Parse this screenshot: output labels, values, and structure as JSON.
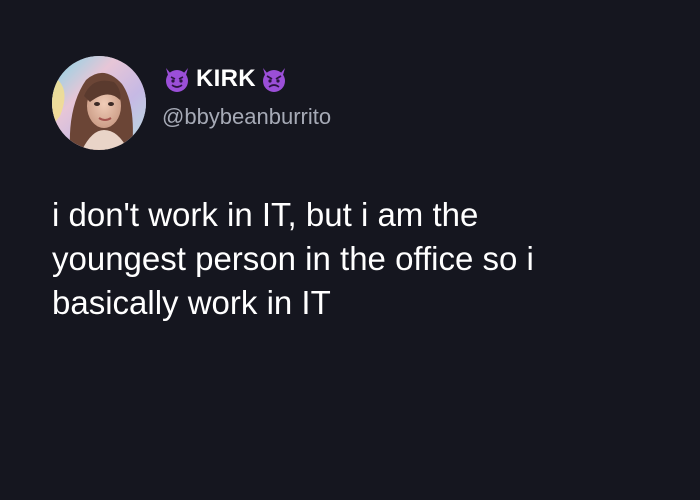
{
  "author": {
    "display_name": "KIRK",
    "handle": "@bbybeanburrito",
    "name_emoji_left": "smiling-imp-emoji",
    "name_emoji_right": "angry-imp-emoji",
    "avatar": "profile-photo"
  },
  "tweet": {
    "text_lines": [
      "i don't work in IT, but i am the",
      "youngest person in the office so i",
      "basically work in IT"
    ]
  },
  "colors": {
    "background": "#15161f",
    "text_primary": "#ffffff",
    "text_secondary": "#a6aab6",
    "emoji_purple": "#9b4fd8"
  }
}
